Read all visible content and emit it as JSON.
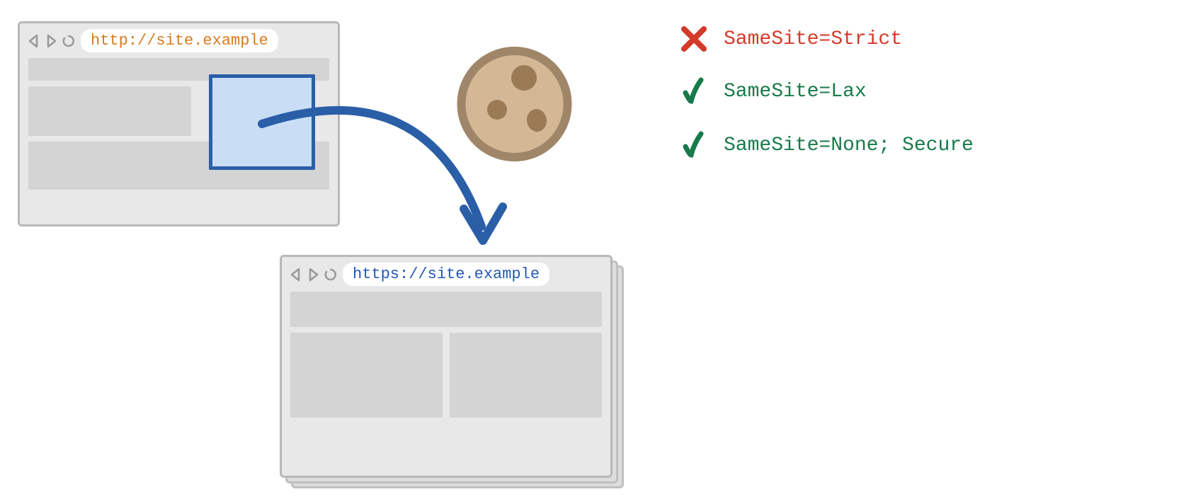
{
  "browser1": {
    "url": "http://site.example"
  },
  "browser2": {
    "url": "https://site.example"
  },
  "legend": {
    "items": [
      {
        "status": "x",
        "label": "SameSite=Strict"
      },
      {
        "status": "check",
        "label": "SameSite=Lax"
      },
      {
        "status": "check",
        "label": "SameSite=None; Secure"
      }
    ]
  }
}
